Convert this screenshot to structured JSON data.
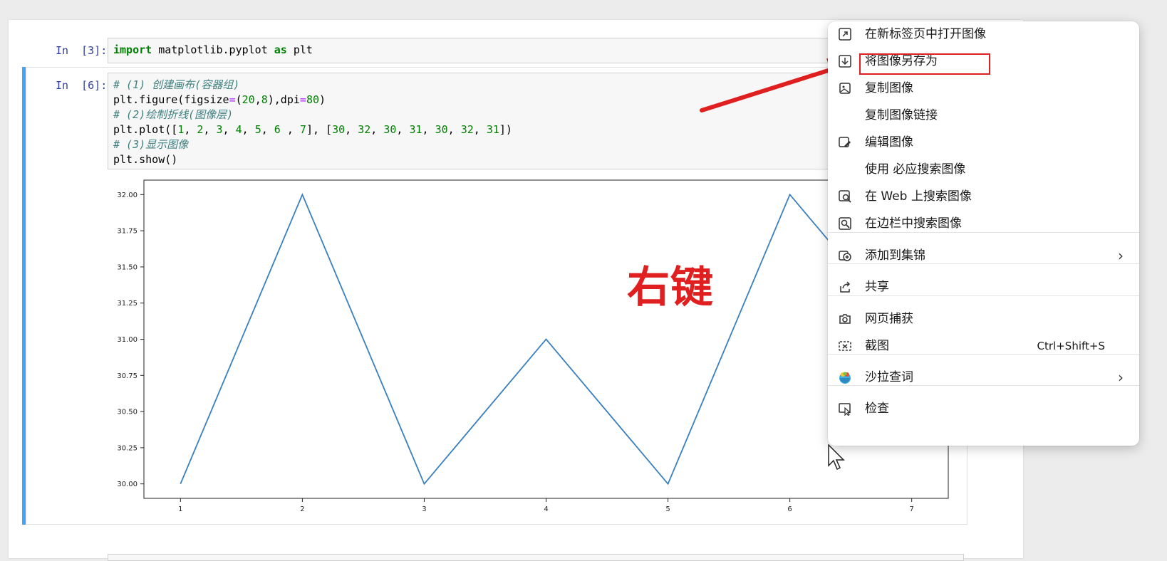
{
  "cells": [
    {
      "prompt": "In  [3]:",
      "code": {
        "kw_import": "import",
        "mod": " matplotlib.pyplot ",
        "kw_as": "as",
        "alias": " plt"
      }
    },
    {
      "prompt": "In  [6]:",
      "lines": {
        "c1": "# (1) 创建画布(容器组)",
        "l2a": "plt.figure(figsize",
        "l2b": "=",
        "l2c": "(",
        "l2d": "20",
        "l2e": ",",
        "l2f": "8",
        "l2g": "),dpi",
        "l2h": "=",
        "l2i": "80",
        "l2j": ")",
        "c3": "# (2)绘制折线(图像层)",
        "l4a": "plt.plot([",
        "l4nums1": [
          "1",
          "2",
          "3",
          "4",
          "5",
          "6 ",
          "7"
        ],
        "l4mid": "], [",
        "l4nums2": [
          "30",
          "32",
          "30",
          "31",
          "30",
          "32",
          "31"
        ],
        "l4end": "])",
        "c5": "# (3)显示图像",
        "l6": "plt.show()"
      }
    }
  ],
  "chart_data": {
    "type": "line",
    "x": [
      1,
      2,
      3,
      4,
      5,
      6,
      7
    ],
    "series": [
      {
        "values": [
          30,
          32,
          30,
          31,
          30,
          32,
          31
        ],
        "color": "#3a7fbf"
      }
    ],
    "xticks": [
      "1",
      "2",
      "3",
      "4",
      "5",
      "6",
      "7"
    ],
    "yticks": [
      "30.00",
      "30.25",
      "30.50",
      "30.75",
      "31.00",
      "31.25",
      "31.50",
      "31.75",
      "32.00"
    ],
    "xlim": [
      0.7,
      7.3
    ],
    "ylim": [
      29.9,
      32.1
    ],
    "grid": false
  },
  "annotation": {
    "label": "右键",
    "color": "#e02020"
  },
  "context_menu": {
    "items": [
      {
        "label": "在新标签页中打开图像",
        "icon": "open-in-new-tab-icon"
      },
      {
        "label": "将图像另存为",
        "icon": "save-image-icon"
      },
      {
        "label": "复制图像",
        "icon": "copy-image-icon"
      },
      {
        "label": "复制图像链接",
        "icon": ""
      },
      {
        "label": "编辑图像",
        "icon": "edit-image-icon"
      },
      {
        "label": "使用 必应搜索图像",
        "icon": ""
      },
      {
        "label": "在 Web 上搜索图像",
        "icon": "web-search-icon"
      },
      {
        "label": "在边栏中搜索图像",
        "icon": "sidebar-search-icon"
      },
      {
        "label": "添加到集锦",
        "icon": "add-collection-icon",
        "chevron": "›"
      },
      {
        "label": "共享",
        "icon": "share-icon"
      },
      {
        "label": "网页捕获",
        "icon": "web-capture-icon"
      },
      {
        "label": "截图",
        "icon": "screenshot-icon",
        "shortcut": "Ctrl+Shift+S"
      },
      {
        "label": "沙拉查词",
        "icon": "saladict-icon",
        "chevron": "›"
      },
      {
        "label": "检查",
        "icon": "inspect-icon"
      }
    ]
  }
}
